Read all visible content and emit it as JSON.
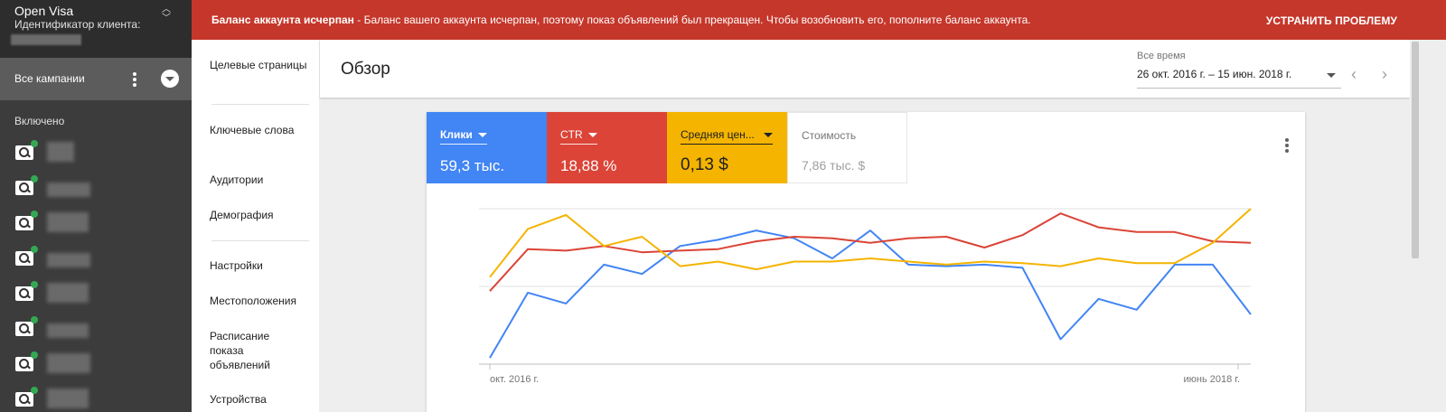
{
  "alert": {
    "title": "Баланс аккаунта исчерпан",
    "message": " - Баланс вашего аккаунта исчерпан, поэтому показ объявлений был прекращен. Чтобы возобновить его, пополните баланс аккаунта.",
    "action": "УСТРАНИТЬ ПРОБЛЕМУ",
    "color": "#c5372b"
  },
  "account": {
    "name": "Open Visa",
    "id_label": "Идентификатор клиента:"
  },
  "sidebar": {
    "all_campaigns": "Все кампании",
    "section_label": "Включено",
    "campaign_icon": "search-icon",
    "status_color": "#34a853"
  },
  "subnav": {
    "items": [
      {
        "label": "Целевые страницы"
      },
      {
        "label": "Ключевые слова"
      },
      {
        "label": "Аудитории"
      },
      {
        "label": "Демография"
      },
      {
        "label": "Настройки"
      },
      {
        "label": "Местоположения"
      },
      {
        "label": "Расписание показа объявлений"
      },
      {
        "label": "Устройства"
      }
    ]
  },
  "header": {
    "title": "Обзор",
    "range_label": "Все время",
    "range_value": "26 окт. 2016 г. – 15 июн. 2018 г."
  },
  "metrics": [
    {
      "name": "Клики",
      "value": "59,3 тыс.",
      "color": "#4285f4",
      "selected": true
    },
    {
      "name": "CTR",
      "value": "18,88 %",
      "color": "#db4437",
      "selected": true
    },
    {
      "name": "Средняя цен...",
      "value": "0,13 $",
      "color": "#f4b400",
      "selected": true
    },
    {
      "name": "Стоимость",
      "value": "7,86 тыс. $",
      "color": "#ffffff",
      "selected": false
    }
  ],
  "chart_data": {
    "type": "line",
    "x_labels": [
      "окт. 2016 г.",
      "июнь 2018 г."
    ],
    "x": [
      1,
      2,
      3,
      4,
      5,
      6,
      7,
      8,
      9,
      10,
      11,
      12,
      13,
      14,
      15,
      16,
      17,
      18,
      19,
      20,
      21,
      22,
      23,
      24,
      25
    ],
    "y_scale": "normalized per series, no axis values shown",
    "ylim": [
      0,
      1
    ],
    "grid": true,
    "series": [
      {
        "name": "Клики",
        "color": "#4285f4",
        "values": [
          0.04,
          0.46,
          0.39,
          0.64,
          0.58,
          0.76,
          0.8,
          0.86,
          0.81,
          0.68,
          0.86,
          0.64,
          0.63,
          0.64,
          0.62,
          0.16,
          0.42,
          0.35,
          0.64,
          0.64,
          0.32
        ]
      },
      {
        "name": "CTR",
        "color": "#db4437",
        "values": [
          0.47,
          0.74,
          0.73,
          0.76,
          0.72,
          0.73,
          0.74,
          0.79,
          0.82,
          0.81,
          0.78,
          0.81,
          0.82,
          0.75,
          0.83,
          0.97,
          0.88,
          0.85,
          0.85,
          0.79,
          0.78
        ]
      },
      {
        "name": "Средняя цена",
        "color": "#f4b400",
        "values": [
          0.56,
          0.87,
          0.96,
          0.76,
          0.82,
          0.63,
          0.66,
          0.61,
          0.66,
          0.66,
          0.68,
          0.66,
          0.64,
          0.66,
          0.65,
          0.63,
          0.68,
          0.65,
          0.65,
          0.78,
          1.0
        ]
      }
    ]
  }
}
